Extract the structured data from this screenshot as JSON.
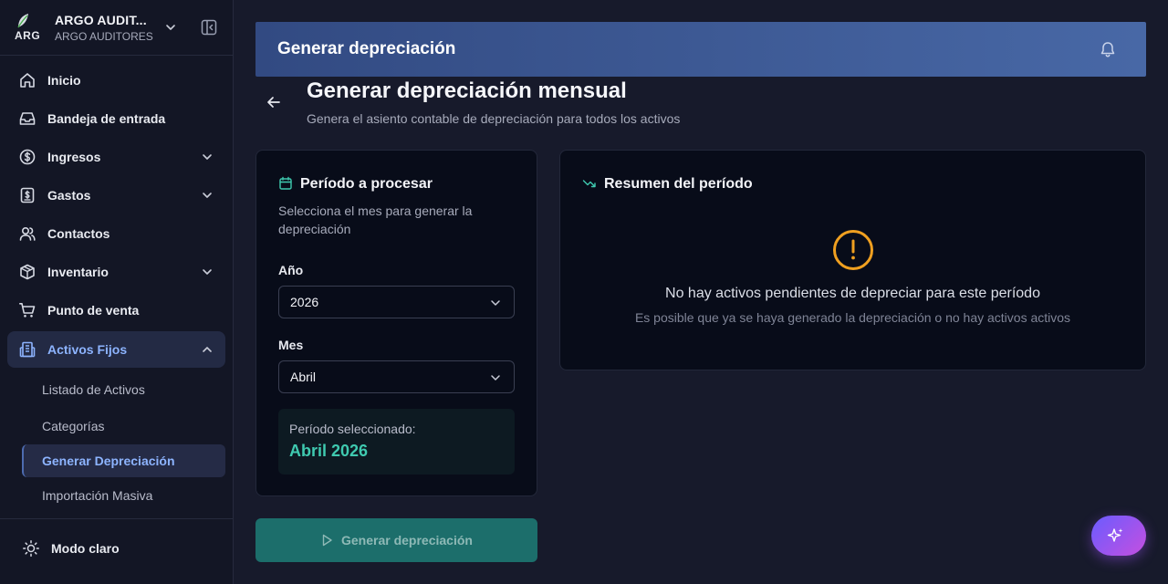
{
  "brand": {
    "logo_text": "ARG",
    "name": "ARGO AUDIT...",
    "subtitle": "ARGO AUDITORES"
  },
  "sidebar": {
    "items": [
      {
        "label": "Inicio",
        "icon": "home-icon"
      },
      {
        "label": "Bandeja de entrada",
        "icon": "inbox-icon"
      },
      {
        "label": "Ingresos",
        "icon": "dollar-circle-icon",
        "expandable": true
      },
      {
        "label": "Gastos",
        "icon": "receipt-dollar-icon",
        "expandable": true
      },
      {
        "label": "Contactos",
        "icon": "users-icon"
      },
      {
        "label": "Inventario",
        "icon": "box-icon",
        "expandable": true
      },
      {
        "label": "Punto de venta",
        "icon": "cart-icon"
      },
      {
        "label": "Activos Fijos",
        "icon": "building-icon",
        "expandable": true,
        "expanded": true,
        "active": true
      }
    ],
    "subitems": [
      {
        "label": "Listado de Activos"
      },
      {
        "label": "Categorías"
      },
      {
        "label": "Generar Depreciación",
        "active": true
      },
      {
        "label": "Importación Masiva"
      }
    ],
    "mode_label": "Modo claro"
  },
  "header": {
    "title": "Generar depreciación"
  },
  "page": {
    "title": "Generar depreciación mensual",
    "subtitle": "Genera el asiento contable de depreciación para todos los activos"
  },
  "period_card": {
    "title": "Período a procesar",
    "description": "Selecciona el mes para generar la depreciación",
    "year_label": "Año",
    "year_value": "2026",
    "month_label": "Mes",
    "month_value": "Abril",
    "selected_label": "Período seleccionado:",
    "selected_value": "Abril 2026"
  },
  "summary_card": {
    "title": "Resumen del período",
    "empty_title": "No hay activos pendientes de depreciar para este período",
    "empty_subtitle": "Es posible que ya se haya generado la depreciación o no hay activos activos"
  },
  "actions": {
    "generate_label": "Generar depreciación"
  },
  "colors": {
    "background": "#171a2b",
    "sidebar": "#131625",
    "header_gradient_start": "#324a82",
    "header_gradient_end": "#4868a6",
    "active_text": "#8db4ff",
    "accent_teal": "#3fcab0",
    "warning": "#f0a020",
    "button_disabled": "#1c6e6b"
  }
}
